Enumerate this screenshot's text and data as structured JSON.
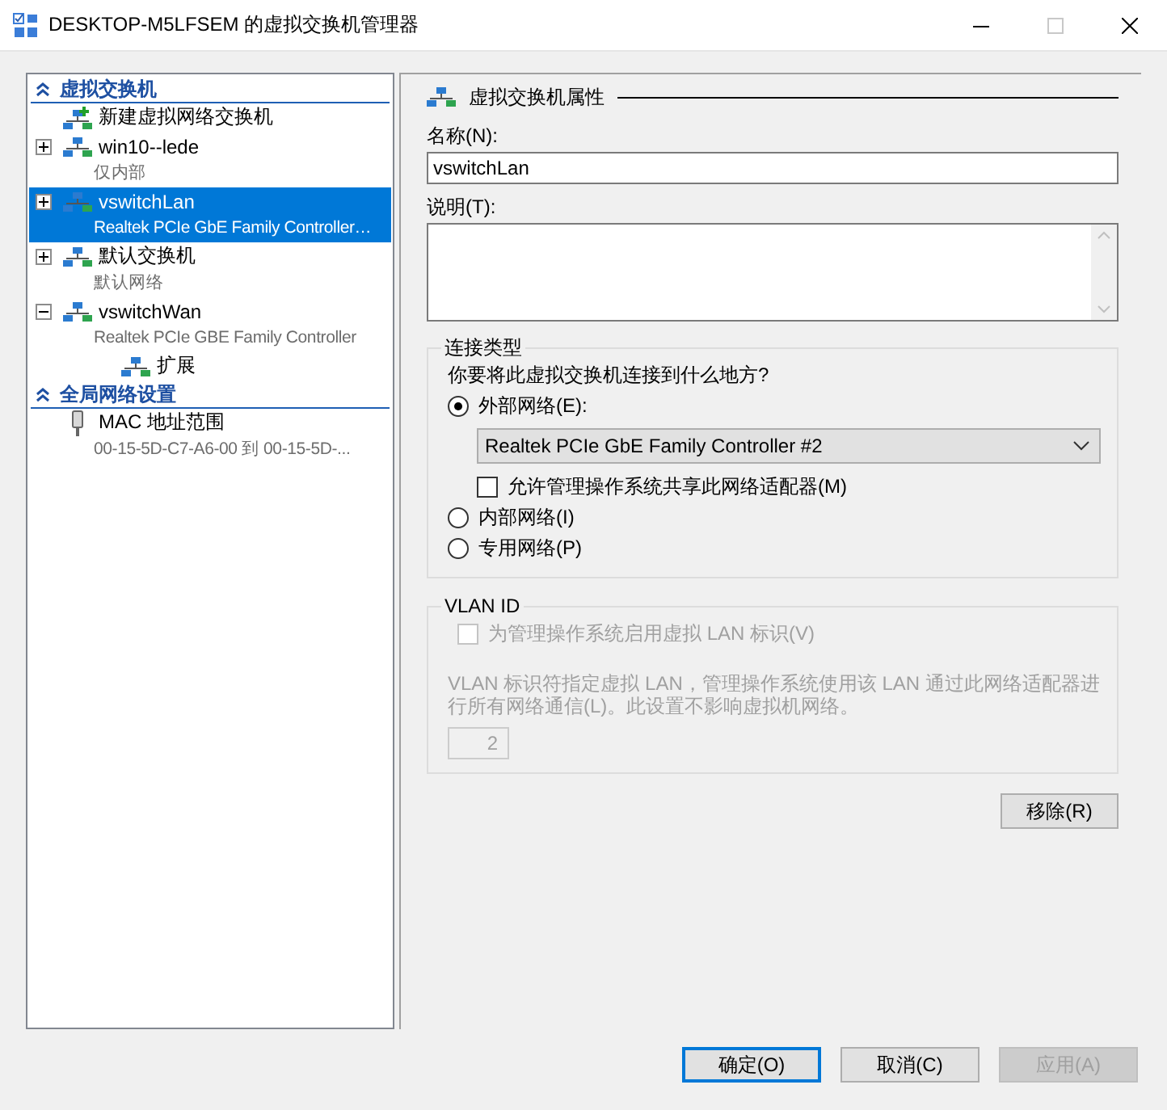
{
  "window": {
    "title": "DESKTOP-M5LFSEM 的虚拟交换机管理器"
  },
  "sidebar": {
    "sections": [
      {
        "title": "虚拟交换机",
        "expanded": true,
        "items": [
          {
            "kind": "add",
            "label": "新建虚拟网络交换机",
            "selected": false
          },
          {
            "kind": "switch",
            "label": "win10--lede",
            "sublabel": "仅内部",
            "expanded": false,
            "selected": false
          },
          {
            "kind": "switch",
            "label": "vswitchLan",
            "sublabel": "Realtek PCIe GbE Family Controller…",
            "expanded": false,
            "selected": true
          },
          {
            "kind": "switch",
            "label": "默认交换机",
            "sublabel": "默认网络",
            "expanded": false,
            "selected": false
          },
          {
            "kind": "switch",
            "label": "vswitchWan",
            "sublabel": "Realtek PCIe GBE Family Controller",
            "expanded": true,
            "selected": false,
            "children": [
              {
                "kind": "child",
                "label": "扩展",
                "selected": false
              }
            ]
          }
        ]
      },
      {
        "title": "全局网络设置",
        "expanded": true,
        "items": [
          {
            "kind": "mac",
            "label": "MAC 地址范围",
            "sublabel": "00-15-5D-C7-A6-00 到 00-15-5D-...",
            "selected": false
          }
        ]
      }
    ]
  },
  "properties": {
    "heading": "虚拟交换机属性",
    "name_label": "名称(N):",
    "name_value": "vswitchLan",
    "description_label": "说明(T):",
    "connection": {
      "title": "连接类型",
      "question": "你要将此虚拟交换机连接到什么地方?",
      "options": [
        {
          "label": "外部网络(E):",
          "selected": true
        },
        {
          "label": "内部网络(I)",
          "selected": false
        },
        {
          "label": "专用网络(P)",
          "selected": false
        }
      ],
      "adapter": "Realtek PCIe GbE Family Controller #2",
      "share": {
        "label": "允许管理操作系统共享此网络适配器(M)",
        "checked": false
      }
    },
    "vlan": {
      "title": "VLAN ID",
      "disabled": true,
      "enable": {
        "label": "为管理操作系统启用虚拟 LAN 标识(V)",
        "checked": false
      },
      "description": "VLAN 标识符指定虚拟 LAN，管理操作系统使用该 LAN 通过此网络适配器进行所有网络通信(L)。此设置不影响虚拟机网络。",
      "value": "2"
    },
    "remove_button": "移除(R)"
  },
  "footer": {
    "buttons": [
      {
        "label": "确定(O)",
        "disabled": false,
        "default": true
      },
      {
        "label": "取消(C)",
        "disabled": false,
        "default": false
      },
      {
        "label": "应用(A)",
        "disabled": true,
        "default": false
      }
    ]
  }
}
